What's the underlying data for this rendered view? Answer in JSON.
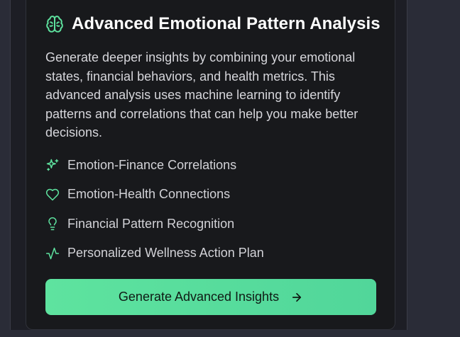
{
  "card": {
    "title": "Advanced Emotional Pattern Analysis",
    "title_icon": "brain-icon",
    "description": "Generate deeper insights by combining your emotional states, financial behaviors, and health metrics. This advanced analysis uses machine learning to identify patterns and correlations that can help you make better decisions.",
    "features": [
      {
        "label": "Emotion-Finance Correlations",
        "icon": "sparkles-icon"
      },
      {
        "label": "Emotion-Health Connections",
        "icon": "heart-icon"
      },
      {
        "label": "Financial Pattern Recognition",
        "icon": "lightbulb-icon"
      },
      {
        "label": "Personalized Wellness Action Plan",
        "icon": "activity-icon"
      }
    ],
    "button": {
      "label": "Generate Advanced Insights",
      "icon": "arrow-right-icon"
    }
  },
  "colors": {
    "accent": "#5ee39f",
    "background": "#18191c",
    "text": "#d6d6db"
  }
}
